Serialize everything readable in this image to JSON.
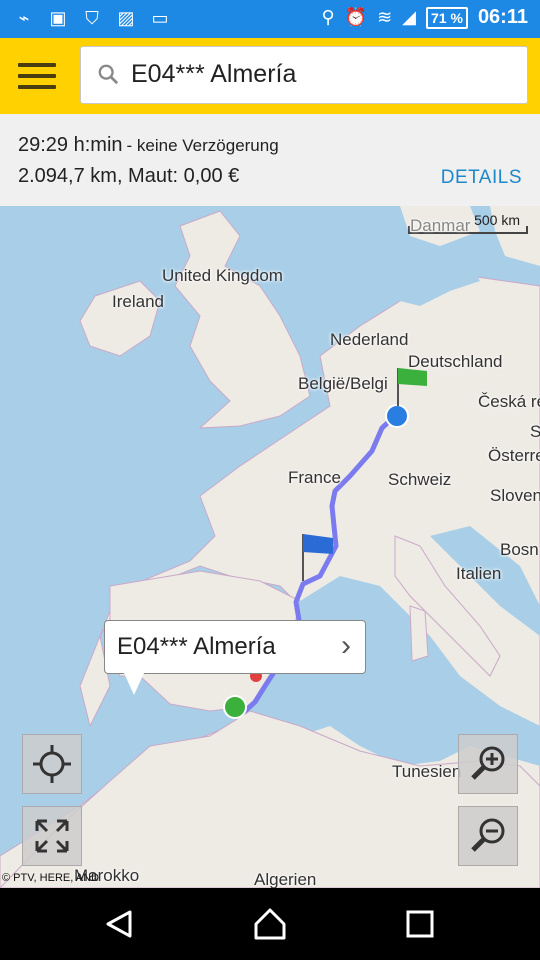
{
  "status_bar": {
    "time": "06:11",
    "battery": "71 %"
  },
  "search": {
    "query": "E04*** Almería"
  },
  "route": {
    "duration": "29:29 h:min",
    "delay": "- keine Verzögerung",
    "distance_toll": "2.094,7 km, Maut: 0,00 €",
    "details_label": "DETAILS"
  },
  "map": {
    "scale_label": "500 km",
    "labels": [
      "Danmar",
      "United Kingdom",
      "Ireland",
      "Nederland",
      "Deutschland",
      "België/Belgi",
      "Česká re",
      "France",
      "Schweiz",
      "Österre",
      "Sloven",
      "Bosn",
      "Italien",
      "Tunesien",
      "Marokko",
      "Algerien",
      "S"
    ],
    "popup_label": "E04*** Almería",
    "copyright": "© PTV, HERE, AND",
    "route_color": "#7b7bef",
    "start_marker_color": "#2a7de1",
    "end_marker_color": "#3cb03c"
  },
  "controls": {
    "locate": "crosshair-icon",
    "fullscreen": "expand-icon",
    "zoom_in": "zoom-in-icon",
    "zoom_out": "zoom-out-icon"
  }
}
